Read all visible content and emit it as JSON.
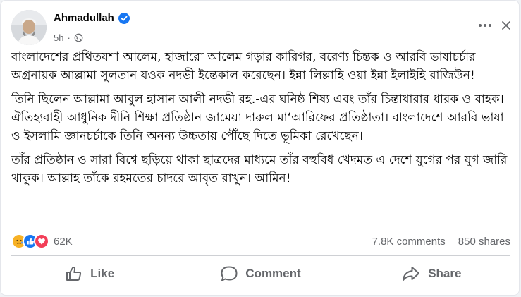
{
  "post": {
    "author": "Ahmadullah",
    "time": "5h",
    "paragraphs": [
      "বাংলাদেশের প্রথিতযশা আলেম, হাজারো আলেম গড়ার কারিগর, বরেণ্য চিন্তক ও আরবি ভাষাচর্চার অগ্রনায়ক আল্লামা সুলতান যওক নদভী ইন্তেকাল করেছেন। ইন্না লিল্লাহি ওয়া ইন্না ইলাইহি রাজিউন!",
      "তিনি ছিলেন আল্লামা আবুল হাসান আলী নদভী রহ.-এর ঘনিষ্ঠ শিষ্য এবং তাঁর চিন্তাধারার ধারক ও বাহক। ঐতিহ্যবাহী আধুনিক দীনি শিক্ষা প্রতিষ্ঠান জামেয়া দারুল মা‘আরিফের প্রতিষ্ঠাতা। বাংলাদেশে আরবি ভাষা ও ইসলামি জ্ঞানচর্চাকে তিনি অনন্য উচ্চতায় পৌঁছে দিতে ভূমিকা রেখেছেন।",
      "তাঁর প্রতিষ্ঠান ও সারা বিশ্বে ছড়িয়ে থাকা ছাত্রদের মাধ্যমে তাঁর বহুবিধ খেদমত এ দেশে যুগের পর যুগ জারি থাকুক। আল্লাহ তাঁকে রহমতের চাদরে আবৃত রাখুন। আমিন!"
    ]
  },
  "reactions": {
    "count": "62K",
    "icons": [
      "sad-reaction-icon",
      "like-reaction-icon",
      "love-reaction-icon"
    ],
    "comments": "7.8K comments",
    "shares": "850 shares"
  },
  "actions": {
    "like": "Like",
    "comment": "Comment",
    "share": "Share"
  },
  "colors": {
    "facebook_blue": "#1877f2",
    "love_red": "#f33e58",
    "sad_yellow": "#f7b125",
    "secondary_text": "#65676b"
  }
}
